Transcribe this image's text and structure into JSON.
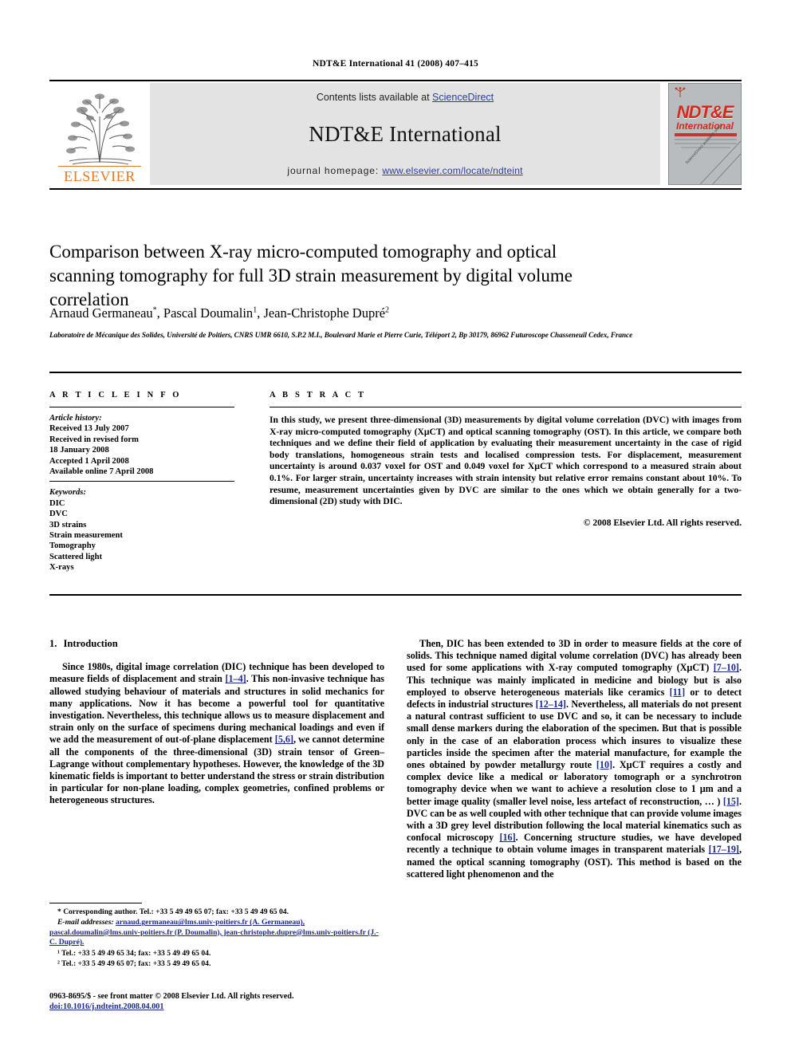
{
  "running_head": "NDT&E International 41 (2008) 407–415",
  "masthead": {
    "publisher_name": "ELSEVIER",
    "contents_prefix": "Contents lists available at ",
    "contents_link": "ScienceDirect",
    "journal_title": "NDT&E International",
    "homepage_prefix": "journal homepage: ",
    "homepage_url": "www.elsevier.com/locate/ndteint",
    "cover": {
      "title_main": "NDT&E",
      "title_sub": "International",
      "tagline_1": "INDEPENDENT NONDESTRUCTIVE TESTING AND EVALUATION",
      "tagline_2": "Ultrasonics · Electromagnetics · Radiography · X-ray CT",
      "tagline_3": "Thermal · Optical · All Non-destructive",
      "diagonal_text": "ScienceDirect available online"
    },
    "link_color": "#2a3f9d",
    "brand_color": "#e87722",
    "cover_accent": "#d42a1e"
  },
  "article": {
    "title": "Comparison between X-ray micro-computed tomography and optical scanning tomography for full 3D strain measurement by digital volume correlation",
    "authors": [
      {
        "name": "Arnaud Germaneau",
        "mark": "*"
      },
      {
        "name": "Pascal Doumalin",
        "mark": "1"
      },
      {
        "name": "Jean-Christophe Dupré",
        "mark": "2"
      }
    ],
    "affiliation": "Laboratoire de Mécanique des Solides, Université de Poitiers, CNRS UMR 6610, S.P.2 M.I., Boulevard Marie et Pierre Curie, Téléport 2, Bp 30179, 86962 Futuroscope Chasseneuil Cedex, France"
  },
  "article_info": {
    "heading": "A R T I C L E   I N F O",
    "history_label": "Article history:",
    "history": [
      "Received 13 July 2007",
      "Received in revised form",
      "18 January 2008",
      "Accepted 1 April 2008",
      "Available online 7 April 2008"
    ],
    "keywords_label": "Keywords:",
    "keywords": [
      "DIC",
      "DVC",
      "3D strains",
      "Strain measurement",
      "Tomography",
      "Scattered light",
      "X-rays"
    ]
  },
  "abstract": {
    "heading": "A B S T R A C T",
    "text": "In this study, we present three-dimensional (3D) measurements by digital volume correlation (DVC) with images from X-ray micro-computed tomography (XµCT) and optical scanning tomography (OST). In this article, we compare both techniques and we define their field of application by evaluating their measurement uncertainty in the case of rigid body translations, homogeneous strain tests and localised compression tests. For displacement, measurement uncertainty is around 0.037 voxel for OST and 0.049 voxel for XµCT which correspond to a measured strain about 0.1%. For larger strain, uncertainty increases with strain intensity but relative error remains constant about 10%. To resume, measurement uncertainties given by DVC are similar to the ones which we obtain generally for a two-dimensional (2D) study with DIC.",
    "copyright": "© 2008 Elsevier Ltd. All rights reserved."
  },
  "body": {
    "section_number": "1.",
    "section_title": "Introduction",
    "left_paragraph_pre": "Since 1980s, digital image correlation (DIC) technique has been developed to measure fields of displacement and strain ",
    "left_ref_1": "[1–4]",
    "left_paragraph_mid": ". This non-invasive technique has allowed studying behaviour of materials and structures in solid mechanics for many applications. Now it has become a powerful tool for quantitative investigation. Nevertheless, this technique allows us to measure displacement and strain only on the surface of specimens during mechanical loadings and even if we add the measurement of out-of-plane displacement ",
    "left_ref_2": "[5,6]",
    "left_paragraph_end": ", we cannot determine all the components of the three-dimensional (3D) strain tensor of Green–Lagrange without complementary hypotheses. However, the knowledge of the 3D kinematic fields is important to better understand the stress or strain distribution in particular for non-plane loading, complex geometries, confined problems or heterogeneous structures.",
    "right_p1": "Then, DIC has been extended to 3D in order to measure fields at the core of solids. This technique named digital volume correlation (DVC) has already been used for some applications with X-ray computed tomography (XµCT) ",
    "right_ref_1": "[7–10]",
    "right_p2": ". This technique was mainly implicated in medicine and biology but is also employed to observe heterogeneous materials like ceramics ",
    "right_ref_2": "[11]",
    "right_p3": " or to detect defects in industrial structures ",
    "right_ref_3": "[12–14]",
    "right_p4": ". Nevertheless, all materials do not present a natural contrast sufficient to use DVC and so, it can be necessary to include small dense markers during the elaboration of the specimen. But that is possible only in the case of an elaboration process which insures to visualize these particles inside the specimen after the material manufacture, for example the ones obtained by powder metallurgy route ",
    "right_ref_4": "[10]",
    "right_p5": ". XµCT requires a costly and complex device like a medical or laboratory tomograph or a synchrotron tomography device when we want to achieve a resolution close to 1 µm and a better image quality (smaller level noise, less artefact of reconstruction, … ) ",
    "right_ref_5": "[15]",
    "right_p6": ". DVC can be as well coupled with other technique that can provide volume images with a 3D grey level distribution following the local material kinematics such as confocal microscopy ",
    "right_ref_6": "[16]",
    "right_p7": ". Concerning structure studies, we have developed recently a technique to obtain volume images in transparent materials ",
    "right_ref_7": "[17–19]",
    "right_p8": ", named the optical scanning tomography (OST). This method is based on the scattered light phenomenon and the"
  },
  "footnotes": {
    "corresponding": "* Corresponding author. Tel.: +33 5 49 49 65 07; fax: +33 5 49 49 65 04.",
    "email_label": "E-mail addresses:",
    "emails": "arnaud.germaneau@lms.univ-poitiers.fr (A. Germaneau), pascal.doumalin@lms.univ-poitiers.fr (P. Doumalin), jean-christophe.dupre@lms.univ-poitiers.fr (J.-C. Dupré).",
    "note_1": "¹ Tel.: +33 5 49 49 65 34; fax: +33 5 49 49 65 04.",
    "note_2": "² Tel.: +33 5 49 49 65 07; fax: +33 5 49 49 65 04."
  },
  "footer": {
    "issn_line": "0963-8695/$ - see front matter © 2008 Elsevier Ltd. All rights reserved.",
    "doi": "doi:10.1016/j.ndteint.2008.04.001"
  }
}
